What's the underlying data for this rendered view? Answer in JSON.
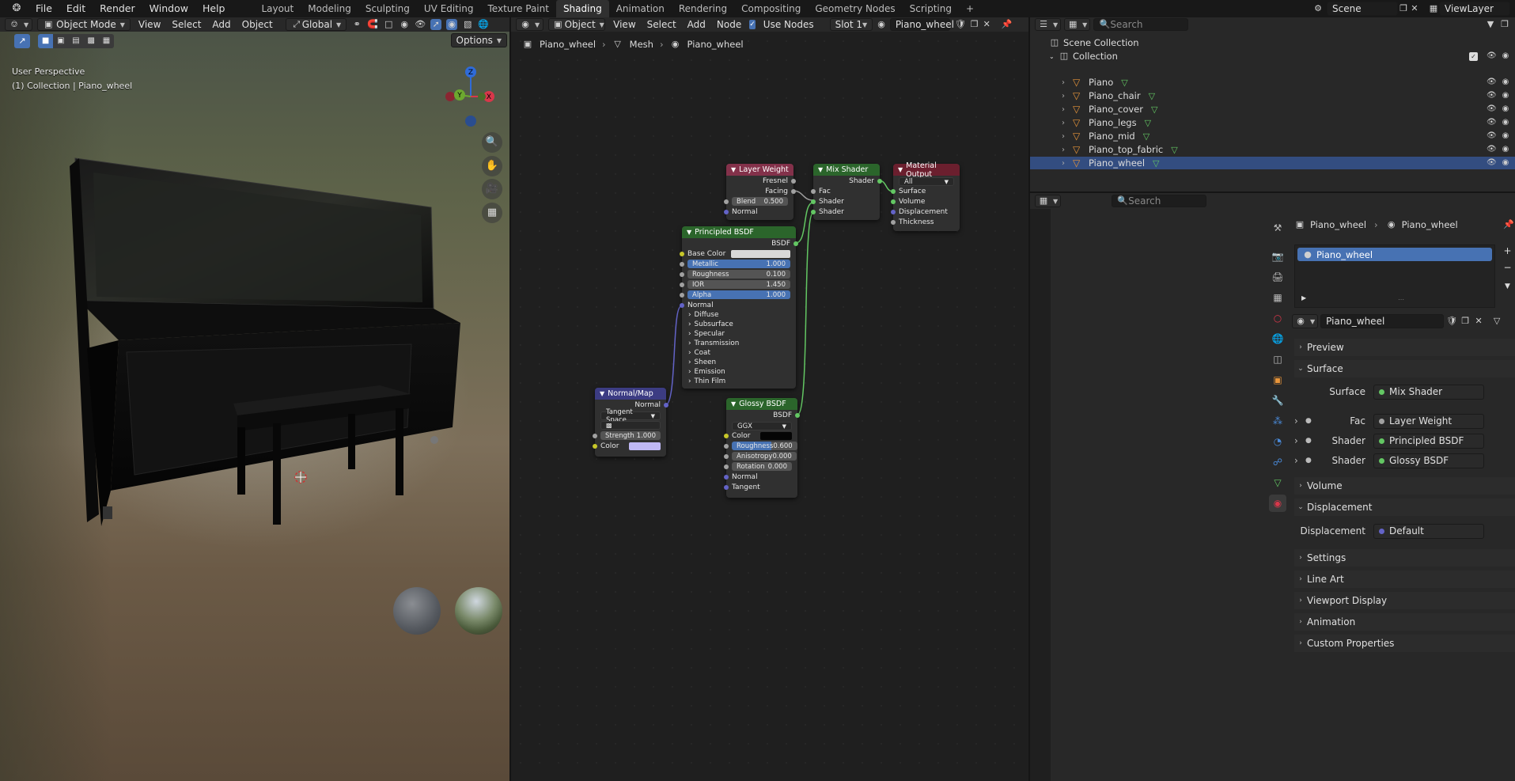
{
  "topbar": {
    "menus": [
      "File",
      "Edit",
      "Render",
      "Window",
      "Help"
    ],
    "workspaces": [
      "Layout",
      "Modeling",
      "Sculpting",
      "UV Editing",
      "Texture Paint",
      "Shading",
      "Animation",
      "Rendering",
      "Compositing",
      "Geometry Nodes",
      "Scripting"
    ],
    "active_workspace": "Shading",
    "add_tab": "+",
    "scene": "Scene",
    "view_layer": "ViewLayer"
  },
  "viewport": {
    "mode": "Object Mode",
    "menus": [
      "View",
      "Select",
      "Add",
      "Object"
    ],
    "orientation": "Global",
    "options": "Options",
    "info_line1": "User Perspective",
    "info_line2": "(1) Collection | Piano_wheel",
    "gizmo": {
      "z": "Z",
      "x": "X",
      "y": "Y"
    }
  },
  "node_header": {
    "type": "Object",
    "menus": [
      "View",
      "Select",
      "Add",
      "Node"
    ],
    "use_nodes_label": "Use Nodes",
    "slot": "Slot 1",
    "material": "Piano_wheel"
  },
  "breadcrumb": [
    "Piano_wheel",
    "Mesh",
    "Piano_wheel"
  ],
  "nodes": {
    "layer_weight": {
      "title": "Layer Weight",
      "fresnel": "Fresnel",
      "facing": "Facing",
      "blend_label": "Blend",
      "blend": "0.500",
      "normal": "Normal"
    },
    "mix_shader": {
      "title": "Mix Shader",
      "shader_out": "Shader",
      "fac": "Fac",
      "shader1": "Shader",
      "shader2": "Shader"
    },
    "material_output": {
      "title": "Material Output",
      "target": "All",
      "surface": "Surface",
      "volume": "Volume",
      "displacement": "Displacement",
      "thickness": "Thickness"
    },
    "principled": {
      "title": "Principled BSDF",
      "bsdf": "BSDF",
      "base_color": "Base Color",
      "metallic_label": "Metallic",
      "metallic": "1.000",
      "roughness_label": "Roughness",
      "roughness": "0.100",
      "ior_label": "IOR",
      "ior": "1.450",
      "alpha_label": "Alpha",
      "alpha": "1.000",
      "normal": "Normal",
      "panels": [
        "Diffuse",
        "Subsurface",
        "Specular",
        "Transmission",
        "Coat",
        "Sheen",
        "Emission",
        "Thin Film"
      ]
    },
    "normal_map": {
      "title": "Normal/Map",
      "normal": "Normal",
      "space": "Tangent Space",
      "strength_label": "Strength",
      "strength": "1.000",
      "color": "Color"
    },
    "glossy": {
      "title": "Glossy BSDF",
      "bsdf": "BSDF",
      "distribution": "GGX",
      "color": "Color",
      "roughness_label": "Roughness",
      "roughness": "0.600",
      "anisotropy_label": "Anisotropy",
      "anisotropy": "0.000",
      "rotation_label": "Rotation",
      "rotation": "0.000",
      "normal": "Normal",
      "tangent": "Tangent"
    }
  },
  "outliner": {
    "search_placeholder": "Search",
    "scene_collection": "Scene Collection",
    "collection": "Collection",
    "objects": [
      "Piano",
      "Piano_chair",
      "Piano_cover",
      "Piano_legs",
      "Piano_mid",
      "Piano_top_fabric",
      "Piano_wheel"
    ]
  },
  "properties": {
    "search_placeholder": "Search",
    "breadcrumb_object": "Piano_wheel",
    "breadcrumb_material": "Piano_wheel",
    "slot_item": "Piano_wheel",
    "material_name": "Piano_wheel",
    "panels": {
      "preview": "Preview",
      "surface": "Surface",
      "surface_label": "Surface",
      "surface_value": "Mix Shader",
      "fac_label": "Fac",
      "fac_value": "Layer Weight",
      "shader1_label": "Shader",
      "shader1_value": "Principled BSDF",
      "shader2_label": "Shader",
      "shader2_value": "Glossy BSDF",
      "volume": "Volume",
      "displacement": "Displacement",
      "displacement_label": "Displacement",
      "displacement_value": "Default",
      "settings": "Settings",
      "line_art": "Line Art",
      "viewport_display": "Viewport Display",
      "animation": "Animation",
      "custom_properties": "Custom Properties"
    }
  },
  "colors": {
    "accent": "#4772b3",
    "active_tab": "#303030",
    "node_shader": "#2b652b",
    "node_input": "#83314a",
    "node_output": "#6b1f2e",
    "node_vector": "#3c3c83"
  }
}
